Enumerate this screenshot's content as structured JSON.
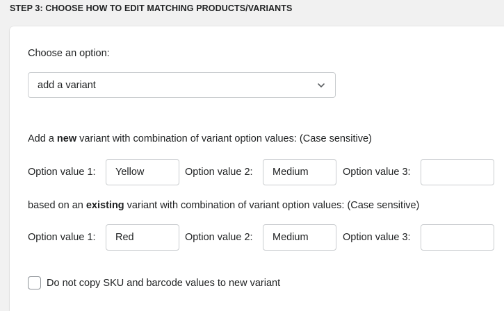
{
  "step": {
    "title": "STEP 3: CHOOSE HOW TO EDIT MATCHING PRODUCTS/VARIANTS"
  },
  "option_select": {
    "label": "Choose an option:",
    "selected": "add a variant",
    "icon": "chevron-down-icon"
  },
  "new_variant": {
    "prefix": "Add a ",
    "emphasis": "new",
    "suffix": " variant with combination of variant option values: (Case sensitive)",
    "fields": [
      {
        "label": "Option value 1:",
        "value": "Yellow"
      },
      {
        "label": "Option value 2:",
        "value": "Medium"
      },
      {
        "label": "Option value 3:",
        "value": ""
      }
    ]
  },
  "existing_variant": {
    "prefix": "based on an ",
    "emphasis": "existing",
    "suffix": " variant with combination of variant option values: (Case sensitive)",
    "fields": [
      {
        "label": "Option value 1:",
        "value": "Red"
      },
      {
        "label": "Option value 2:",
        "value": "Medium"
      },
      {
        "label": "Option value 3:",
        "value": ""
      }
    ]
  },
  "copy_option": {
    "label": "Do not copy SKU and barcode values to new variant",
    "checked": false
  },
  "colors": {
    "background": "#f1f1f1",
    "card": "#ffffff",
    "border": "#c9cccf",
    "text": "#202223"
  }
}
